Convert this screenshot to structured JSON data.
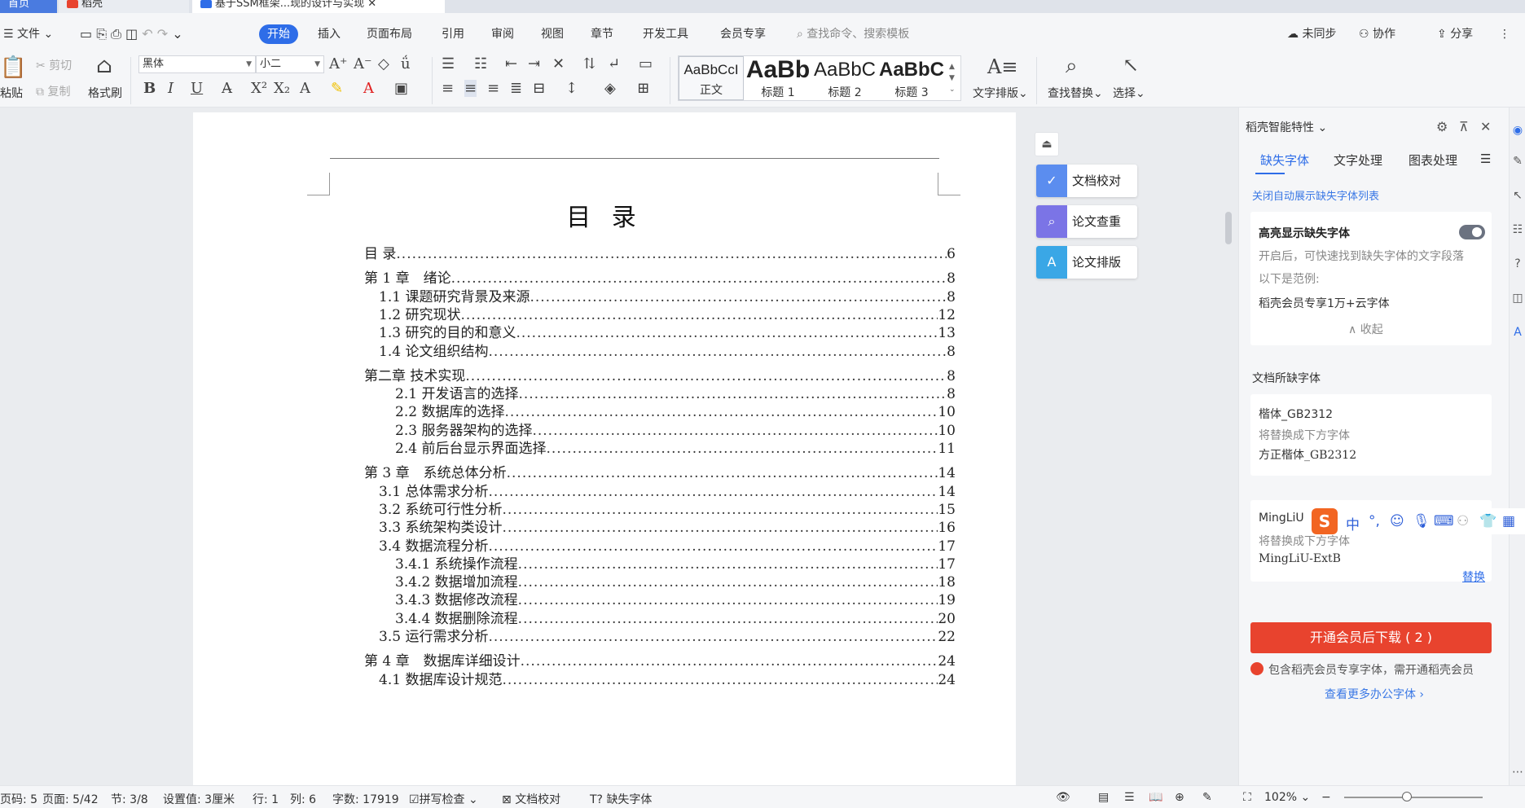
{
  "tabs": {
    "home": "首页",
    "dk": "稻壳",
    "doc": "基于SSM框架...现的设计与实现"
  },
  "menubar": {
    "file": "文件",
    "items": [
      "开始",
      "插入",
      "页面布局",
      "引用",
      "审阅",
      "视图",
      "章节",
      "开发工具",
      "会员专享"
    ],
    "search_placeholder": "查找命令、搜索模板",
    "right": [
      "未同步",
      "协作",
      "分享"
    ]
  },
  "ribbon": {
    "paste": "粘贴",
    "cut": "剪切",
    "copy": "复制",
    "format_painter": "格式刷",
    "font_name": "黑体",
    "font_size": "小二",
    "styles": [
      {
        "sample": "AaBbCcI",
        "label": "正文"
      },
      {
        "sample": "AaBb",
        "label": "标题 1"
      },
      {
        "sample": "AaBbC",
        "label": "标题 2"
      },
      {
        "sample": "AaBbC",
        "label": "标题 3"
      }
    ],
    "text_layout": "文字排版",
    "find_replace": "查找替换",
    "select": "选择"
  },
  "document": {
    "toc_title": "目 录",
    "toc": [
      {
        "text": "目 录",
        "page": "6",
        "indent": 0
      },
      {
        "text": "第 1 章　绪论",
        "page": "8",
        "indent": 0
      },
      {
        "text": "1.1 课题研究背景及来源",
        "page": "8",
        "indent": 1
      },
      {
        "text": "1.2 研究现状",
        "page": "12",
        "indent": 1
      },
      {
        "text": "1.3 研究的目的和意义",
        "page": "13",
        "indent": 1
      },
      {
        "text": "1.4 论文组织结构",
        "page": "8",
        "indent": 1
      },
      {
        "text": "第二章 技术实现",
        "page": "8",
        "indent": 0
      },
      {
        "text": "2.1 开发语言的选择",
        "page": "8",
        "indent": 2
      },
      {
        "text": "2.2 数据库的选择",
        "page": "10",
        "indent": 2
      },
      {
        "text": "2.3 服务器架构的选择",
        "page": "10",
        "indent": 2
      },
      {
        "text": "2.4 前后台显示界面选择",
        "page": "11",
        "indent": 2
      },
      {
        "text": "第 3 章　系统总体分析",
        "page": "14",
        "indent": 0
      },
      {
        "text": "3.1 总体需求分析",
        "page": "14",
        "indent": 1
      },
      {
        "text": "3.2 系统可行性分析",
        "page": "15",
        "indent": 1
      },
      {
        "text": "3.3 系统架构类设计",
        "page": "16",
        "indent": 1
      },
      {
        "text": "3.4 数据流程分析",
        "page": "17",
        "indent": 1
      },
      {
        "text": "3.4.1 系统操作流程",
        "page": "17",
        "indent": 2
      },
      {
        "text": "3.4.2 数据增加流程",
        "page": "18",
        "indent": 2
      },
      {
        "text": "3.4.3 数据修改流程",
        "page": "19",
        "indent": 2
      },
      {
        "text": "3.4.4 数据删除流程",
        "page": "20",
        "indent": 2
      },
      {
        "text": "3.5 运行需求分析",
        "page": "22",
        "indent": 1
      },
      {
        "text": "第 4 章　数据库详细设计",
        "page": "24",
        "indent": 0
      },
      {
        "text": "4.1 数据库设计规范",
        "page": "24",
        "indent": 1
      }
    ]
  },
  "float_tools": [
    "文档校对",
    "论文查重",
    "论文排版"
  ],
  "panel": {
    "title": "稻壳智能特性",
    "tabs": [
      "缺失字体",
      "文字处理",
      "图表处理"
    ],
    "close_auto_link": "关闭自动展示缺失字体列表",
    "highlight": {
      "title": "高亮显示缺失字体",
      "desc1": "开启后，可快速找到缺失字体的文字段落",
      "desc2": "以下是范例:",
      "example": "稻壳会员专享1万+云字体",
      "collapse": "收起"
    },
    "missing_fonts_label": "文档所缺字体",
    "fonts": [
      {
        "name": "楷体_GB2312",
        "hint": "将替换成下方字体",
        "replacement": "方正楷体_GB2312",
        "action": ""
      },
      {
        "name": "MingLiU",
        "hint": "将替换成下方字体",
        "replacement": "MingLiU-ExtB",
        "action": "替换"
      }
    ],
    "cta": "开通会员后下载 ( 2 )",
    "warning": "包含稻壳会员专享字体，需开通稻壳会员",
    "more_link": "查看更多办公字体"
  },
  "ime": {
    "logo": "S",
    "mode": "中"
  },
  "statusbar": {
    "items": [
      "页码: 5",
      "页面: 5/42",
      "节: 3/8",
      "设置值: 3厘米",
      "行: 1",
      "列: 6",
      "字数: 17919",
      "拼写检查",
      "文档校对",
      "缺失字体"
    ],
    "zoom": "102%",
    "zoom_fraction": 0.45
  },
  "colors": {
    "accent": "#2e6de8",
    "cta": "#e8432e",
    "panel_bg": "#f5f6f8"
  }
}
